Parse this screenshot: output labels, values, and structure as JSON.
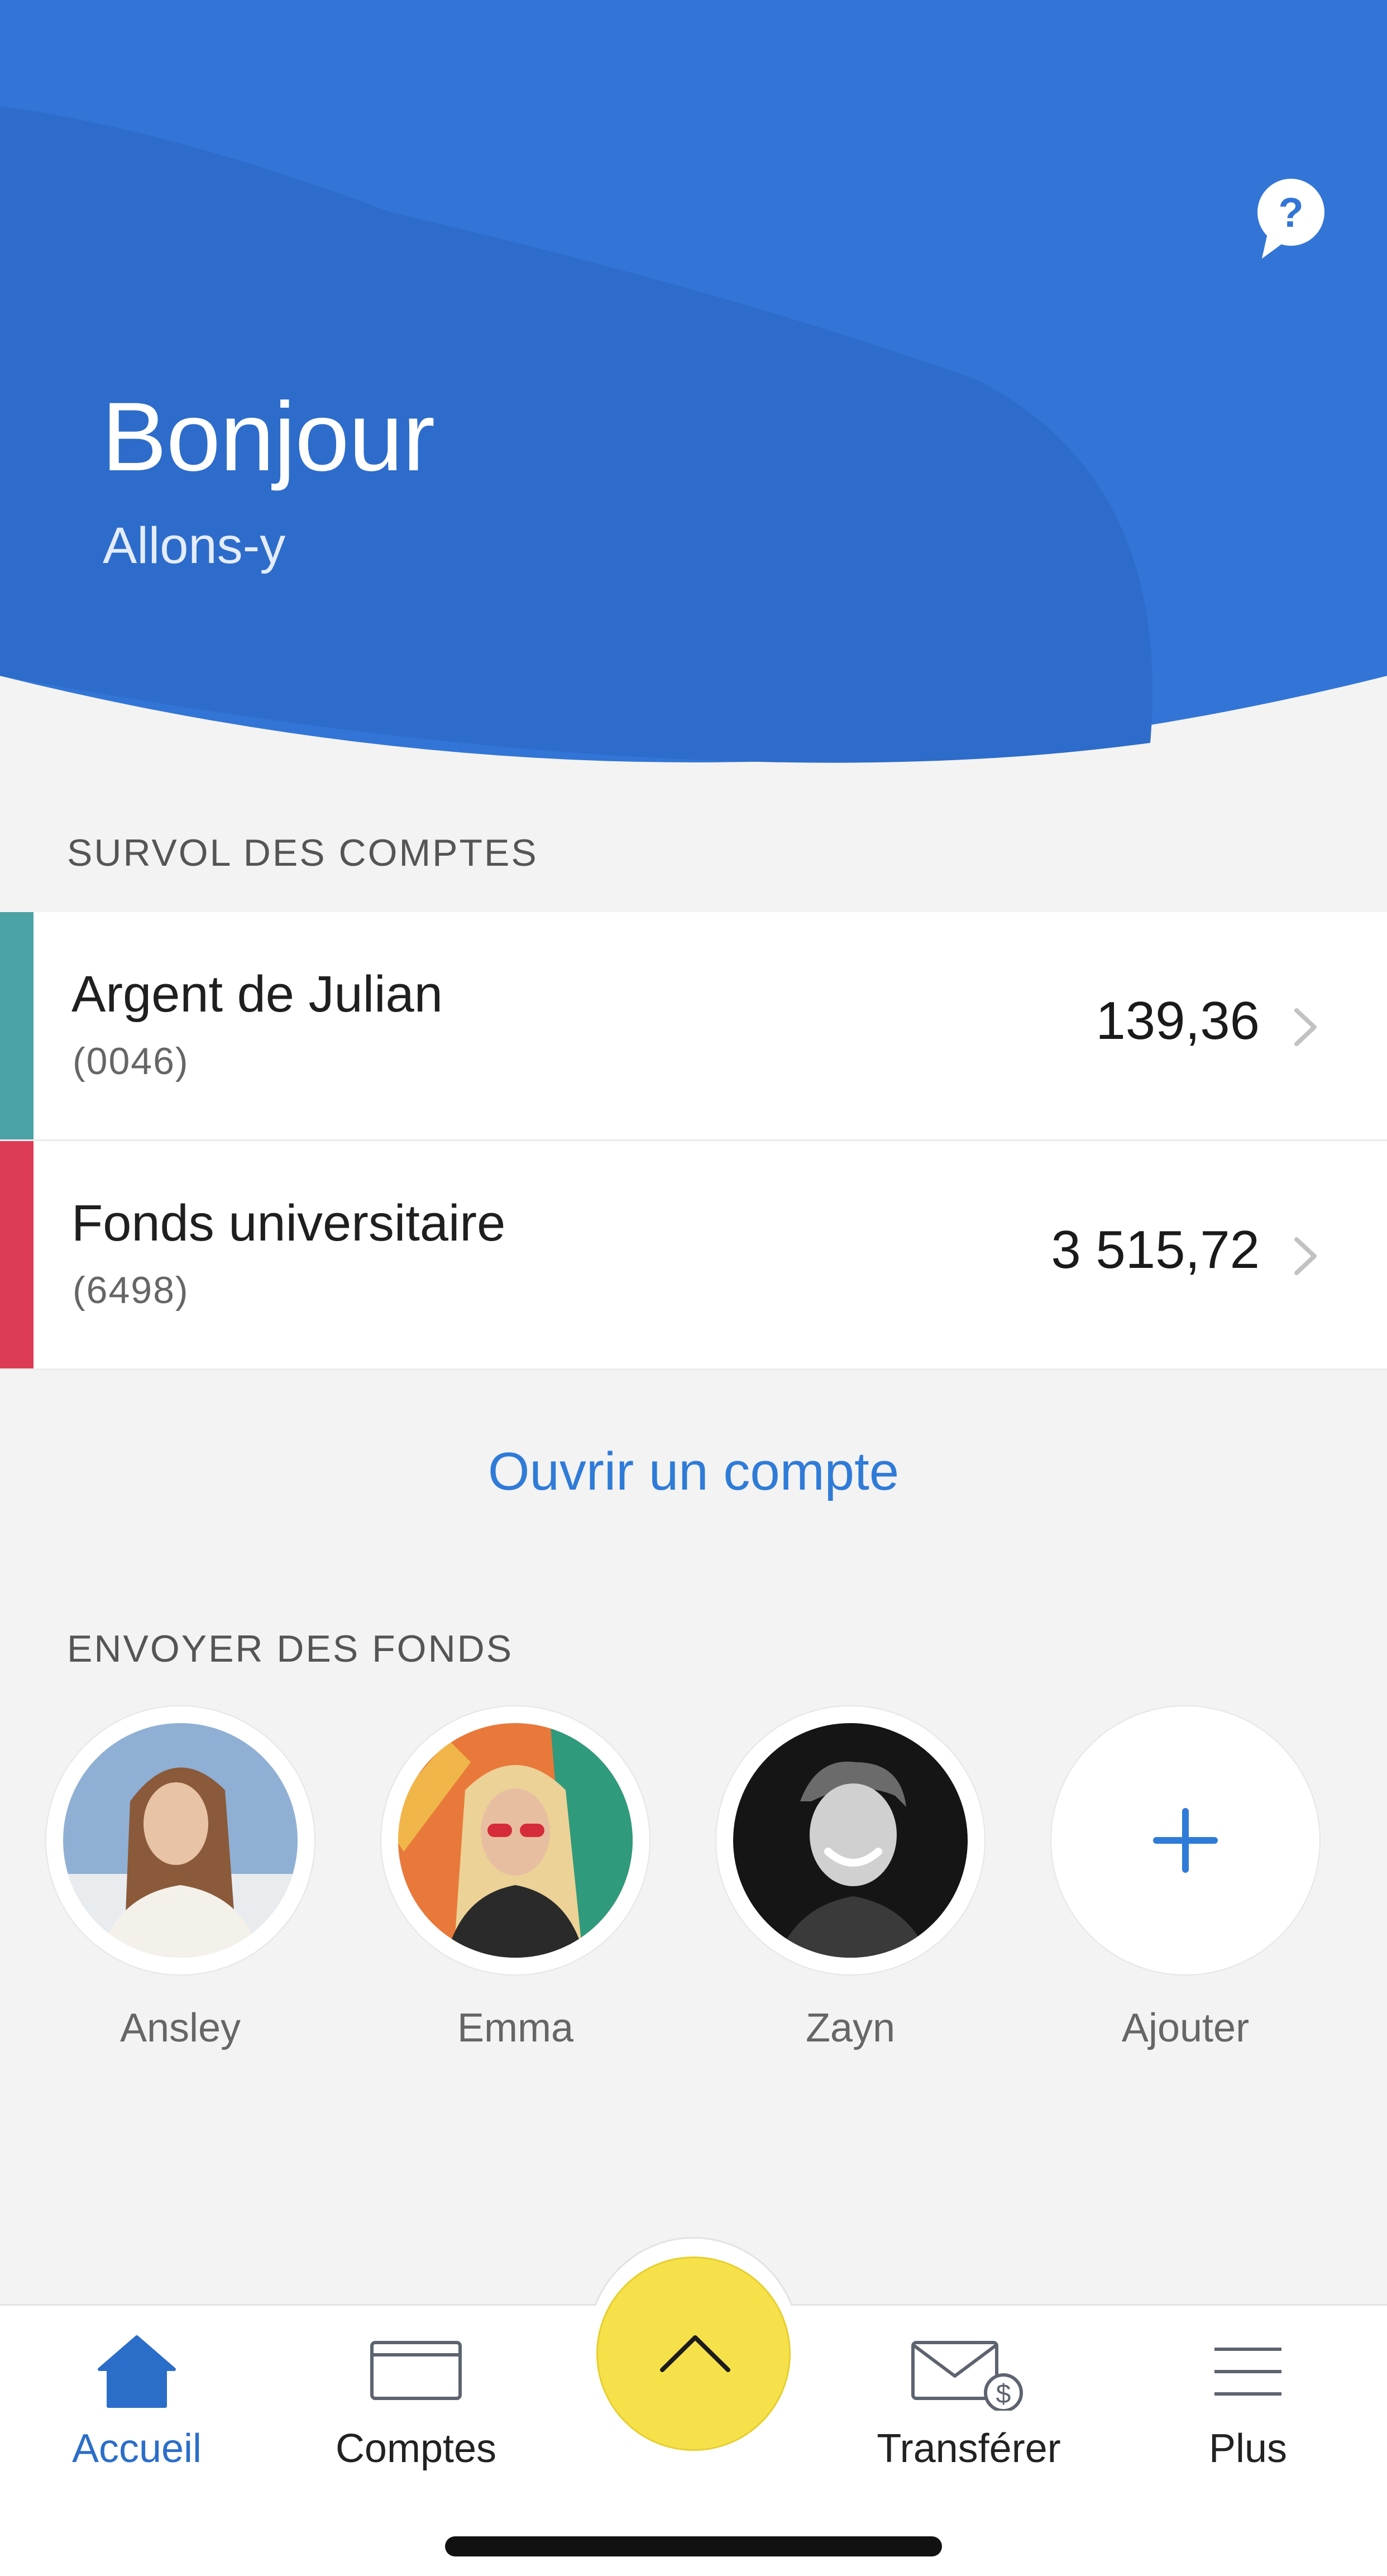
{
  "header": {
    "greeting": "Bonjour",
    "subtitle": "Allons-y",
    "help_icon": "help-chat-bubble-icon",
    "colors": {
      "primary": "#3275d6",
      "dark_wave": "#2d6cca"
    }
  },
  "accounts_overview": {
    "title": "SURVOL DES COMPTES",
    "items": [
      {
        "name": "Argent de Julian",
        "number": "(0046)",
        "balance": "139,36",
        "color": "#4ba3a6"
      },
      {
        "name": "Fonds universitaire",
        "number": "(6498)",
        "balance": "3 515,72",
        "color": "#dd3b55"
      }
    ],
    "open_account_label": "Ouvrir un compte"
  },
  "send_funds": {
    "title": "ENVOYER DES FONDS",
    "contacts": [
      {
        "name": "Ansley"
      },
      {
        "name": "Emma"
      },
      {
        "name": "Zayn"
      },
      {
        "name": "Ajouter",
        "icon": "plus-icon"
      }
    ]
  },
  "tabbar": {
    "items": [
      {
        "label": "Accueil",
        "icon": "home-icon",
        "active": true
      },
      {
        "label": "Comptes",
        "icon": "card-icon",
        "active": false
      },
      {
        "label": "Transférer",
        "icon": "envelope-dollar-icon",
        "active": false
      },
      {
        "label": "Plus",
        "icon": "menu-icon",
        "active": false
      }
    ],
    "center_button_icon": "chevron-up-icon",
    "active_color": "#2b6ec9",
    "fab_color": "#f6e14b"
  }
}
